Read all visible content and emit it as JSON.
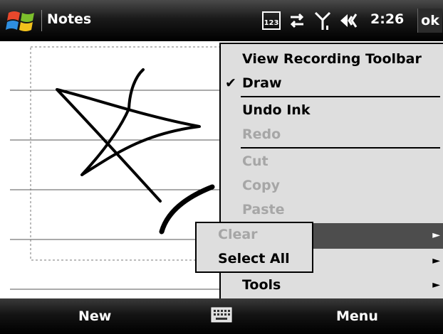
{
  "titlebar": {
    "app_title": "Notes",
    "clock": "2:26",
    "ok_label": "ok",
    "input_mode": "123",
    "colors": {
      "bar": "#000000",
      "text": "#ffffff"
    }
  },
  "popup_menu": {
    "items": [
      {
        "label": "View Recording Toolbar",
        "state": "enabled",
        "checked": false,
        "submenu": false
      },
      {
        "label": "Draw",
        "state": "enabled",
        "checked": true,
        "submenu": false
      },
      {
        "label": "Undo Ink",
        "state": "enabled",
        "checked": false,
        "submenu": false
      },
      {
        "label": "Redo",
        "state": "disabled",
        "checked": false,
        "submenu": false
      },
      {
        "label": "Cut",
        "state": "disabled",
        "checked": false,
        "submenu": false
      },
      {
        "label": "Copy",
        "state": "disabled",
        "checked": false,
        "submenu": false
      },
      {
        "label": "Paste",
        "state": "disabled",
        "checked": false,
        "submenu": false
      },
      {
        "label": "",
        "state": "highlighted",
        "checked": false,
        "submenu": true
      },
      {
        "label": "",
        "state": "enabled",
        "checked": false,
        "submenu": true
      },
      {
        "label": "Tools",
        "state": "enabled",
        "checked": false,
        "submenu": true
      }
    ],
    "check_glyph": "✔",
    "submenu_arrow": "►"
  },
  "submenu": {
    "items": [
      {
        "label": "Clear",
        "state": "disabled"
      },
      {
        "label": "Select All",
        "state": "enabled"
      }
    ]
  },
  "menu_bar": {
    "left_softkey": "New",
    "right_softkey": "Menu",
    "center_icon": "keyboard-icon"
  }
}
